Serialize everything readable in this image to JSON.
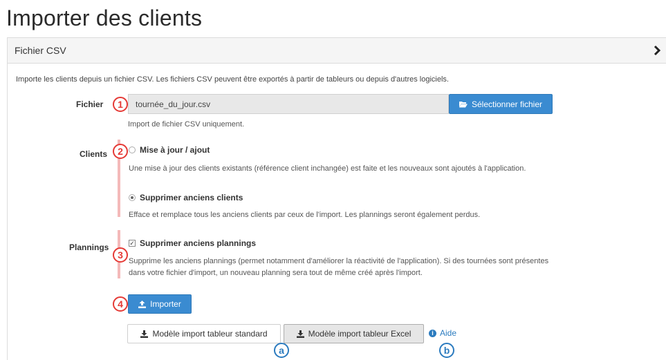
{
  "page": {
    "title": "Importer des clients"
  },
  "panel": {
    "heading": "Fichier CSV",
    "intro": "Importe les clients depuis un fichier CSV. Les fichiers CSV peuvent être exportés à partir de tableurs ou depuis d'autres logiciels."
  },
  "file": {
    "label": "Fichier",
    "value": "tournée_du_jour.csv",
    "button": "Sélectionner fichier",
    "help": "Import de fichier CSV uniquement."
  },
  "clients": {
    "label": "Clients",
    "option1": {
      "label": "Mise à jour / ajout",
      "help": "Une mise à jour des clients existants (référence client inchangée) est faite et les nouveaux sont ajoutés à l'application."
    },
    "option2": {
      "label": "Supprimer anciens clients",
      "help": "Efface et remplace tous les anciens clients par ceux de l'import. Les plannings seront également perdus."
    }
  },
  "plannings": {
    "label": "Plannings",
    "checkbox": "Supprimer anciens plannings",
    "help": "Supprime les anciens plannings (permet notamment d'améliorer la réactivité de l'application). Si des tournées sont présentes dans votre fichier d'import, un nouveau planning sera tout de même créé après l'import."
  },
  "actions": {
    "import": "Importer",
    "template_standard": "Modèle import tableur standard",
    "template_excel": "Modèle import tableur Excel",
    "help": "Aide"
  },
  "annotations": {
    "n1": "1",
    "n2": "2",
    "n3": "3",
    "n4": "4",
    "a": "a",
    "b": "b"
  }
}
